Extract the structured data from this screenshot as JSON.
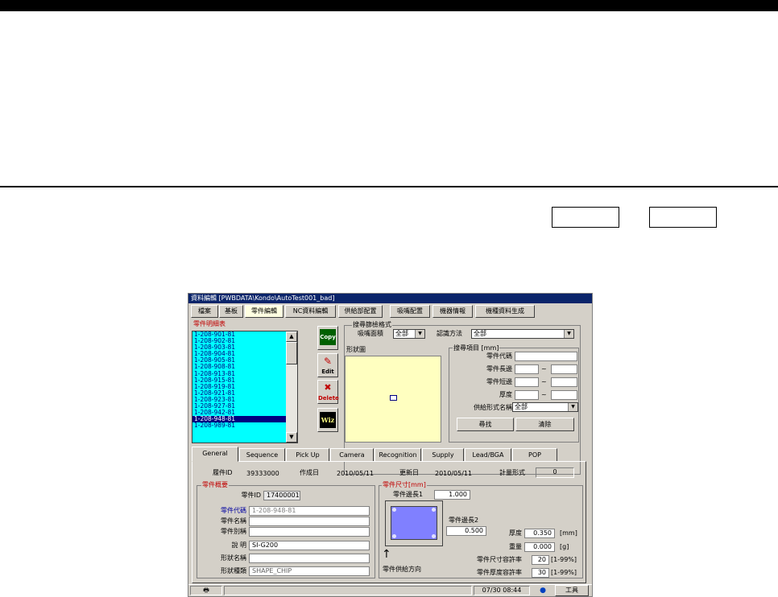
{
  "window": {
    "title": "資料編輯 [PWBDATA\\Kondo\\AutoTest001_bad]"
  },
  "menu_tabs": [
    "檔案",
    "基板",
    "零件編輯",
    "NC資料編輯",
    "供給部配置",
    "吸嘴配置",
    "機器情報",
    "機種資料生成"
  ],
  "parts_list": {
    "legend": "零件明細表",
    "items": [
      "1-208-901-81",
      "1-208-902-81",
      "1-208-903-81",
      "1-208-904-81",
      "1-208-905-81",
      "1-208-908-81",
      "1-208-913-81",
      "1-208-915-81",
      "1-208-919-81",
      "1-208-921-81",
      "1-208-923-81",
      "1-208-927-81",
      "1-208-942-81",
      "1-208-948-81",
      "1-208-989-81"
    ],
    "selected": "1-208-948-81"
  },
  "side_buttons": {
    "copy": "Copy",
    "edit": "Edit",
    "delete": "Delete",
    "wiz": "Wiz"
  },
  "search": {
    "legend": "搜尋篩檢格式",
    "nozzle_label": "吸嘴面積",
    "nozzle_value": "全部",
    "recog_label": "認識方法",
    "recog_value": "全部",
    "shape_label": "形狀圖",
    "items_legend": "搜尋項目 [mm]",
    "code_label": "零件代碼",
    "long_label": "零件長邊",
    "short_label": "零件短邊",
    "thick_label": "厚度",
    "tilde": "~",
    "supply_label": "供給形式名稱",
    "supply_value": "全部",
    "search_button": "尋找",
    "clear_button": "清除"
  },
  "property_tabs": [
    "General",
    "Sequence",
    "Pick Up",
    "Camera",
    "Recognition",
    "Supply",
    "Lead/BGA",
    "POP"
  ],
  "general": {
    "history_id_label": "履件ID",
    "history_id": "39333000",
    "created_label": "作成日",
    "created": "2010/05/11",
    "updated_label": "更新日",
    "updated": "2010/05/11",
    "measure_label": "計量形式",
    "measure": "0",
    "overview_legend": "零件概要",
    "part_id_label": "零件ID",
    "part_id": "17400001",
    "code_label": "零件代碼",
    "code": "1-208-948-81",
    "name_label": "零件名稱",
    "name": "",
    "alias_label": "零件別稱",
    "alias": "",
    "desc_label": "說 明",
    "desc": "SI-G200",
    "shape_name_label": "形狀名稱",
    "shape_name": "",
    "shape_type_label": "形狀種類",
    "shape_type": "SHAPE_CHIP",
    "size_legend": "零件尺寸[mm]",
    "edge1_label": "零件邊長1",
    "edge1": "1.000",
    "edge2_label": "零件邊長2",
    "edge2": "0.500",
    "thick_label": "厚度",
    "thick": "0.350",
    "thick_unit": "[mm]",
    "weight_label": "重量",
    "weight": "0.000",
    "weight_unit": "[g]",
    "size_tol_label": "零件尺寸容許率",
    "size_tol": "20",
    "size_tol_unit": "[1-99%]",
    "thick_tol_label": "零件厚度容許率",
    "thick_tol": "30",
    "thick_tol_unit": "[1-99%]",
    "feed_dir_label": "零件供給方向",
    "feed_arrow": "↑"
  },
  "status": {
    "datetime": "07/30 08:44",
    "tools": "工具"
  },
  "colors": {
    "title_bg": "#0a246a",
    "list_bg": "#00ffff",
    "selected_bg": "#000080",
    "shape_bg": "#ffffc0",
    "part_fill": "#8080ff"
  }
}
